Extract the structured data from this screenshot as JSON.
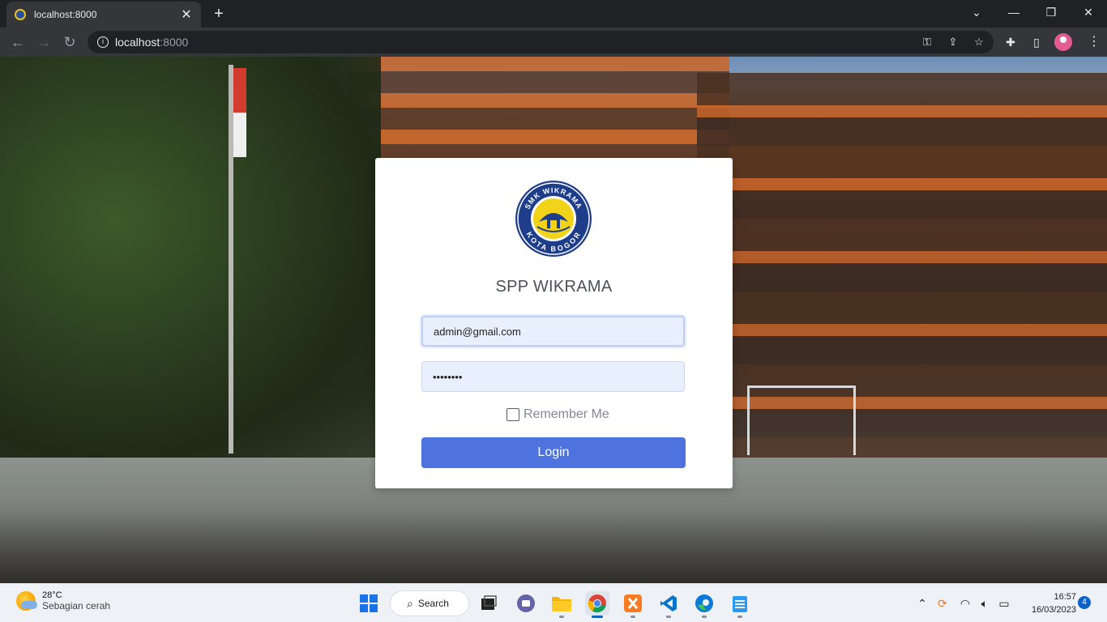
{
  "browser": {
    "tab_title": "localhost:8000",
    "tab_close": "✕",
    "new_tab": "+",
    "url_host": "localhost",
    "url_port": ":8000"
  },
  "page": {
    "logo_text_top": "SMK WIKRAMA",
    "logo_text_bottom": "KOTA BOGOR",
    "app_title": "SPP WIKRAMA",
    "email_value": "admin@gmail.com",
    "password_value": "••••••••",
    "remember_label": "Remember Me",
    "login_label": "Login",
    "colors": {
      "primary": "#4e73df",
      "input_bg": "#e8f0fe",
      "logo_blue": "#1e3e8c",
      "logo_yellow": "#f1d31a"
    }
  },
  "taskbar": {
    "temperature": "28°C",
    "weather": "Sebagian cerah",
    "search_label": "Search",
    "time": "16:57",
    "date": "16/03/2023",
    "notification_count": "4"
  }
}
